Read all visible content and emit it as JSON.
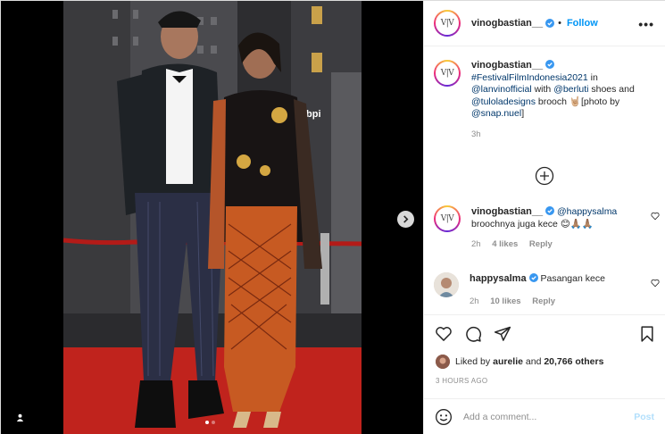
{
  "post": {
    "username": "vinogbastian__",
    "follow_label": "Follow",
    "more_label": "•••",
    "avatar_text": "V|V"
  },
  "caption": {
    "username": "vinogbastian__",
    "hashtag": "#FestivalFilmIndonesia2021",
    "in_text": " in ",
    "mention1": "@lanvinofficial",
    "with_text": " with ",
    "mention2": "@berluti",
    "shoes_text": " shoes and ",
    "mention3": "@tuloladesigns",
    "brooch_text": " brooch 🤘🏼[photo by ",
    "mention4": "@snap.nuel",
    "close_text": "]",
    "time": "3h"
  },
  "comments": [
    {
      "username": "vinogbastian__",
      "mention": "@happysalma",
      "text": "broochnya juga kece 😊🙏🏽🙏🏽",
      "time": "2h",
      "likes": "4 likes",
      "reply": "Reply"
    },
    {
      "username": "happysalma",
      "text": "Pasangan kece",
      "time": "2h",
      "likes": "10 likes",
      "reply": "Reply"
    }
  ],
  "likes": {
    "prefix": "Liked by ",
    "user": "aurelie",
    "middle": " and ",
    "others": "20,766 others"
  },
  "timestamp": "3 HOURS AGO",
  "add_comment": {
    "placeholder": "Add a comment...",
    "post_label": "Post"
  },
  "carousel": {
    "count": 2,
    "active": 1
  },
  "icons": [
    "user-tag-icon",
    "next-arrow-icon",
    "verified-icon",
    "heart-icon",
    "comment-icon",
    "share-icon",
    "save-icon",
    "emoji-icon",
    "plus-circle-icon"
  ],
  "colors": {
    "accent": "#0095f6",
    "link": "#00376b",
    "muted": "#8e8e8e",
    "carpet": "#c0231d"
  }
}
